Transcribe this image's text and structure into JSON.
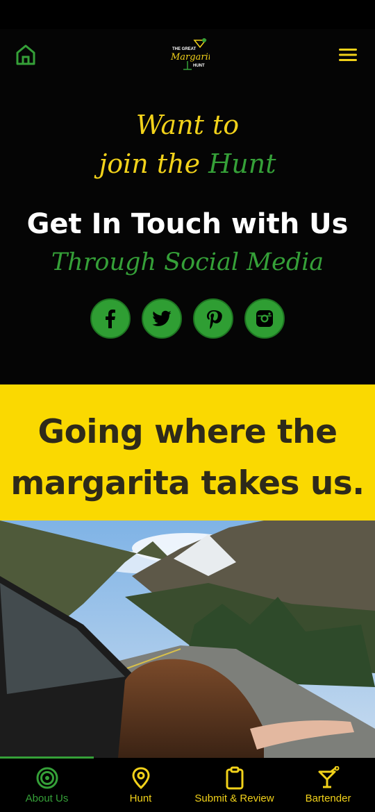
{
  "header": {
    "logo": {
      "line1": "THE GREAT",
      "line2": "Margarita",
      "line3": "HUNT"
    }
  },
  "hero": {
    "want_to": "Want to",
    "join_the": "join the",
    "hunt": "Hunt",
    "get_in_touch": "Get In Touch with Us",
    "through_social": "Through Social Media",
    "social": [
      {
        "name": "facebook",
        "icon": "facebook-icon",
        "glyph": "f"
      },
      {
        "name": "twitter",
        "icon": "twitter-icon"
      },
      {
        "name": "pinterest",
        "icon": "pinterest-icon",
        "glyph": "p"
      },
      {
        "name": "instagram",
        "icon": "instagram-icon"
      }
    ]
  },
  "tagline": {
    "line1": "Going where the",
    "line2": "margarita takes us."
  },
  "tabs": [
    {
      "label": "About Us",
      "icon": "target-icon",
      "active": true
    },
    {
      "label": "Hunt",
      "icon": "location-pin-icon",
      "active": false
    },
    {
      "label": "Submit & Review",
      "icon": "clipboard-icon",
      "active": false
    },
    {
      "label": "Bartender",
      "icon": "cocktail-icon",
      "active": false
    }
  ],
  "colors": {
    "yellow": "#f2d21a",
    "green": "#35a038",
    "banner": "#fad901",
    "background": "#050505"
  }
}
